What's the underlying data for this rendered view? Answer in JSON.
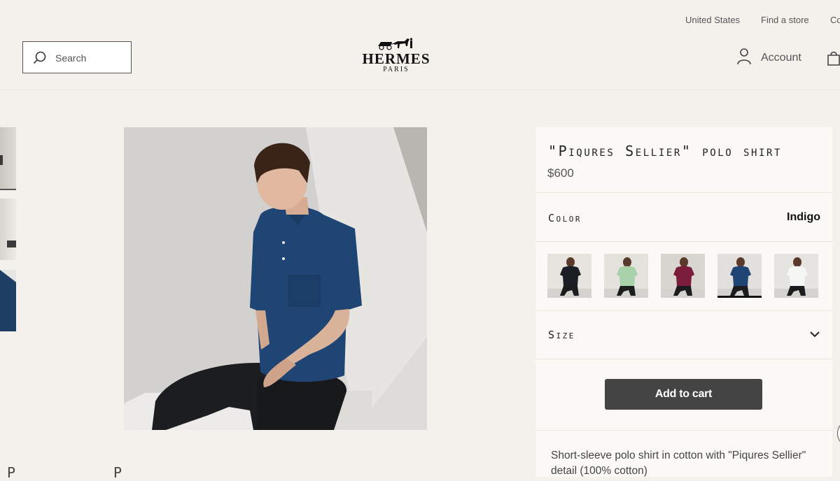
{
  "utility_bar": {
    "country": "United States",
    "find_store": "Find a store",
    "contact_partial": "Co"
  },
  "header": {
    "search_placeholder": "Search",
    "logo_brand": "HERMES",
    "logo_city": "PARIS",
    "account_label": "Account"
  },
  "icons": {
    "search": "search-icon",
    "account": "person-icon",
    "bag": "shopping-bag-icon",
    "size_toggle": "chevron-down-icon"
  },
  "product": {
    "title": "\"Piqures Sellier\" polo shirt",
    "price": "$600",
    "color_label": "Color",
    "color_value": "Indigo",
    "swatches": [
      {
        "name": "Black",
        "shirt": "#1b1e24",
        "bg": "#e7e4df"
      },
      {
        "name": "Mint",
        "shirt": "#a9d1a9",
        "bg": "#e4e2dd"
      },
      {
        "name": "Burgundy",
        "shirt": "#7c1c3c",
        "bg": "#d9d6d1"
      },
      {
        "name": "Indigo",
        "shirt": "#1f4574",
        "bg": "#e2e0dc",
        "selected": true
      },
      {
        "name": "White",
        "shirt": "#f6f6f4",
        "bg": "#e6e4e0"
      }
    ],
    "size_label": "Size",
    "add_to_cart": "Add to cart",
    "description": "Short-sleeve polo shirt in cotton with \"Piqures Sellier\" detail (100% cotton)"
  },
  "colors": {
    "page_bg": "#f4f1ec",
    "panel_bg": "#fbf9f6",
    "button_bg": "#444444",
    "shirt_indigo": "#1f4574"
  },
  "bottom": {
    "partial_left": "P",
    "partial_right": "P"
  }
}
